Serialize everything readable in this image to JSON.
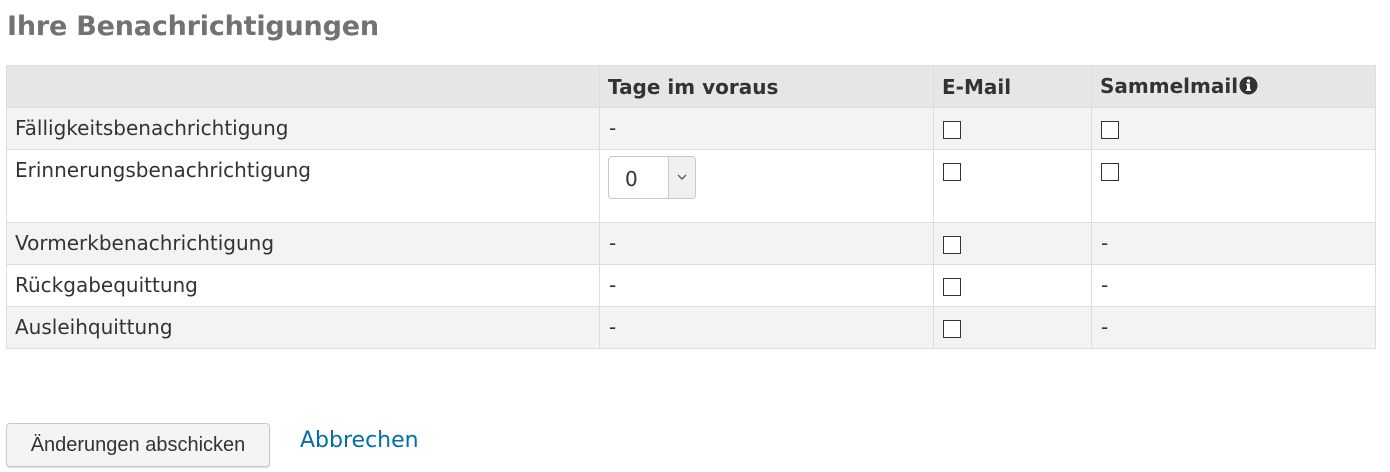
{
  "page": {
    "title": "Ihre Benachrichtigungen"
  },
  "table": {
    "headers": [
      "",
      "Tage im voraus",
      "E-Mail",
      "Sammelmail"
    ],
    "rows": [
      {
        "name": "Fälligkeitsbenachrichtigung",
        "days": "-",
        "email_checked": false,
        "digest": "checkbox",
        "digest_checked": false
      },
      {
        "name": "Erinnerungsbenachrichtigung",
        "days_select": "0",
        "email_checked": false,
        "digest": "checkbox",
        "digest_checked": false
      },
      {
        "name": "Vormerkbenachrichtigung",
        "days": "-",
        "email_checked": false,
        "digest": "-"
      },
      {
        "name": "Rückgabequittung",
        "days": "-",
        "email_checked": false,
        "digest": "-"
      },
      {
        "name": "Ausleihquittung",
        "days": "-",
        "email_checked": false,
        "digest": "-"
      }
    ]
  },
  "actions": {
    "submit_label": "Änderungen abschicken",
    "cancel_label": "Abbrechen"
  },
  "icons": {
    "digest_info": "info-circle-icon",
    "select_arrow": "chevron-down-icon"
  },
  "colors": {
    "link": "#006fab",
    "title": "#727272",
    "header_bg": "#e6e6e6",
    "row_shade": "#f3f3f3"
  }
}
